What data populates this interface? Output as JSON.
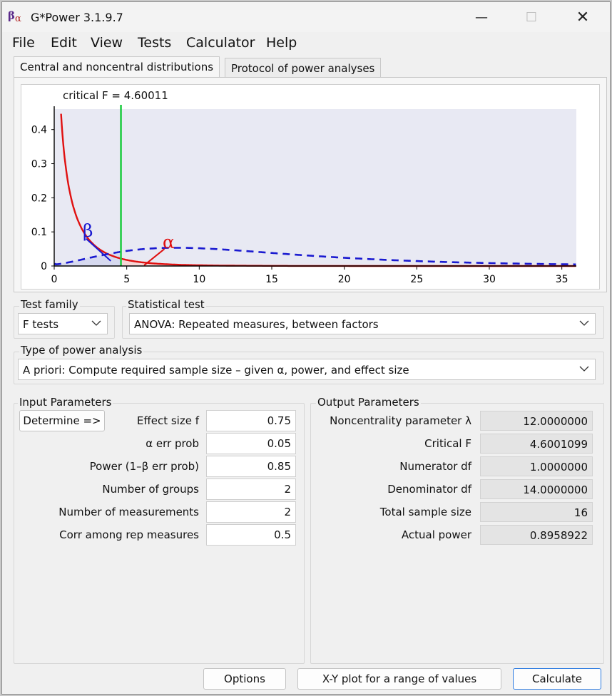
{
  "window": {
    "title": "G*Power 3.1.9.7",
    "minimize": "—",
    "maximize": "☐",
    "close": "✕",
    "icon_beta": "β",
    "icon_alpha": "α"
  },
  "menu": [
    "File",
    "Edit",
    "View",
    "Tests",
    "Calculator",
    "Help"
  ],
  "tabs": [
    "Central and noncentral distributions",
    "Protocol of power analyses"
  ],
  "plot": {
    "critical_label": "critical F =  4.60011",
    "beta_label": "β",
    "alpha_label": "α",
    "x_ticks": [
      "0",
      "5",
      "10",
      "15",
      "20",
      "25",
      "30",
      "35"
    ],
    "y_ticks": [
      "0",
      "0.1",
      "0.2",
      "0.3",
      "0.4"
    ]
  },
  "chart_data": {
    "type": "line",
    "xlim": [
      0,
      36
    ],
    "ylim": [
      0,
      0.46
    ],
    "x_ticks": [
      0,
      5,
      10,
      15,
      20,
      25,
      30,
      35
    ],
    "y_ticks": [
      0,
      0.1,
      0.2,
      0.3,
      0.4
    ],
    "critical_f": 4.60011,
    "df1": 1,
    "df2": 14,
    "noncentrality": 12,
    "series": [
      {
        "style": "solid",
        "color": "#e01010"
      },
      {
        "style": "dashed",
        "color": "#1a1ad0"
      }
    ],
    "critical_line_color": "#22cc44"
  },
  "test_family": {
    "label": "Test family",
    "value": "F tests"
  },
  "statistical_test": {
    "label": "Statistical test",
    "value": "ANOVA: Repeated measures, between factors"
  },
  "power_analysis": {
    "label": "Type of power analysis",
    "value": "A priori: Compute required sample size – given α, power, and effect size"
  },
  "input": {
    "title": "Input Parameters",
    "determine": "Determine =>",
    "params": [
      {
        "label": "Effect size f",
        "value": "0.75"
      },
      {
        "label": "α err prob",
        "value": "0.05"
      },
      {
        "label": "Power (1–β err prob)",
        "value": "0.85"
      },
      {
        "label": "Number of groups",
        "value": "2"
      },
      {
        "label": "Number of measurements",
        "value": "2"
      },
      {
        "label": "Corr among rep measures",
        "value": "0.5"
      }
    ]
  },
  "output": {
    "title": "Output Parameters",
    "params": [
      {
        "label": "Noncentrality parameter λ",
        "value": "12.0000000"
      },
      {
        "label": "Critical F",
        "value": "4.6001099"
      },
      {
        "label": "Numerator df",
        "value": "1.0000000"
      },
      {
        "label": "Denominator df",
        "value": "14.0000000"
      },
      {
        "label": "Total sample size",
        "value": "16"
      },
      {
        "label": "Actual power",
        "value": "0.8958922"
      }
    ]
  },
  "buttons": {
    "options": "Options",
    "xy_plot": "X-Y plot for a range of values",
    "calculate": "Calculate"
  }
}
